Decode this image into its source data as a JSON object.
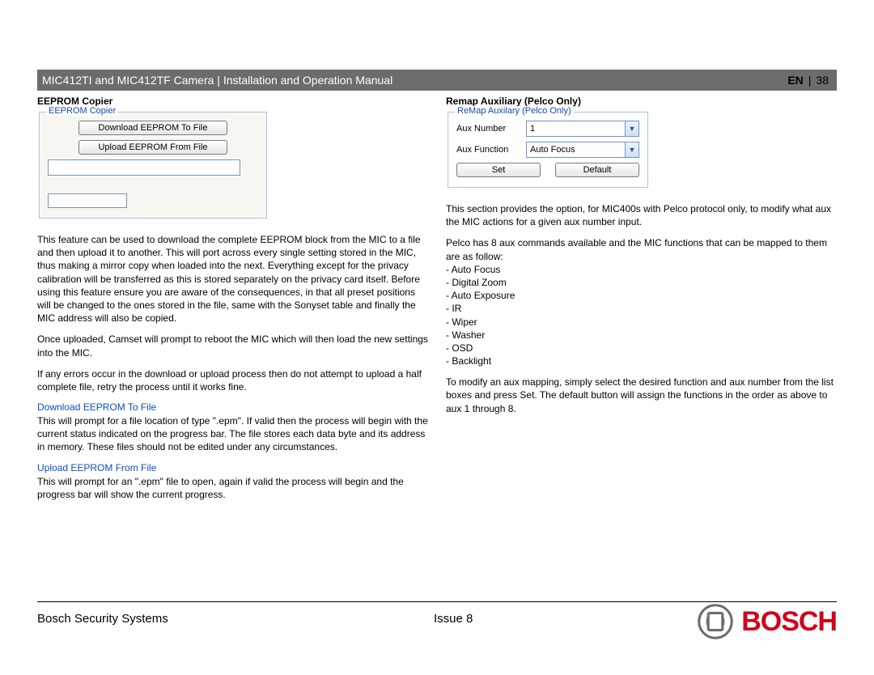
{
  "header": {
    "title": "MIC412TI and MIC412TF Camera | Installation and Operation Manual",
    "lang": "EN",
    "sep": "|",
    "page": "38"
  },
  "left": {
    "title": "EEPROM Copier",
    "fieldset_legend": "EEPROM Copier",
    "btn_download": "Download EEPROM To File",
    "btn_upload": "Upload EEPROM From File",
    "p1": "This feature can be used to download the complete EEPROM block from the MIC to a file and then upload it to another. This will port across every single setting stored in the MIC, thus making a mirror copy when loaded into the next. Everything except for the privacy calibration will be transferred as this is stored separately on the privacy card itself. Before using this feature ensure you are aware of the consequences, in that all preset positions will be changed to the ones stored in the file, same with the Sonyset table and finally the MIC address will also be copied.",
    "p2": "Once uploaded, Camset will prompt to reboot the MIC which will then load the new settings into the MIC.",
    "p3": "If any errors occur in the download or upload process then do not attempt to upload a half complete file, retry the process until it works fine.",
    "sub1": "Download EEPROM To File",
    "p4": "This will prompt for a file location of type \".epm\". If valid then the process will begin with the current status indicated on the progress bar. The file stores each data byte and its address in memory. These files should not be edited under any circumstances.",
    "sub2": "Upload EEPROM From File",
    "p5": "This will prompt for an \".epm\" file to open, again if valid the process will begin and the progress bar will show the current progress."
  },
  "right": {
    "title": "Remap Auxiliary (Pelco Only)",
    "fieldset_legend": "ReMap Auxilary (Pelco Only)",
    "label_auxnum": "Aux Number",
    "label_auxfun": "Aux Function",
    "val_auxnum": "1",
    "val_auxfun": "Auto Focus",
    "btn_set": "Set",
    "btn_default": "Default",
    "p1": "This section provides the option, for MIC400s with Pelco protocol only, to modify what aux the MIC actions for a given aux number input.",
    "p2_intro": "Pelco has 8 aux commands available and the MIC functions that can be mapped to them are as follow:",
    "funcs": [
      "- Auto Focus",
      "- Digital Zoom",
      "- Auto Exposure",
      "- IR",
      "- Wiper",
      "- Washer",
      "- OSD",
      "- Backlight"
    ],
    "p3": "To modify an aux mapping, simply select the desired function and aux number from the list boxes and press Set. The default button will assign the functions in the order as above to aux 1 through 8."
  },
  "footer": {
    "company": "Bosch Security Systems",
    "issue": "Issue 8",
    "brand": "BOSCH"
  }
}
